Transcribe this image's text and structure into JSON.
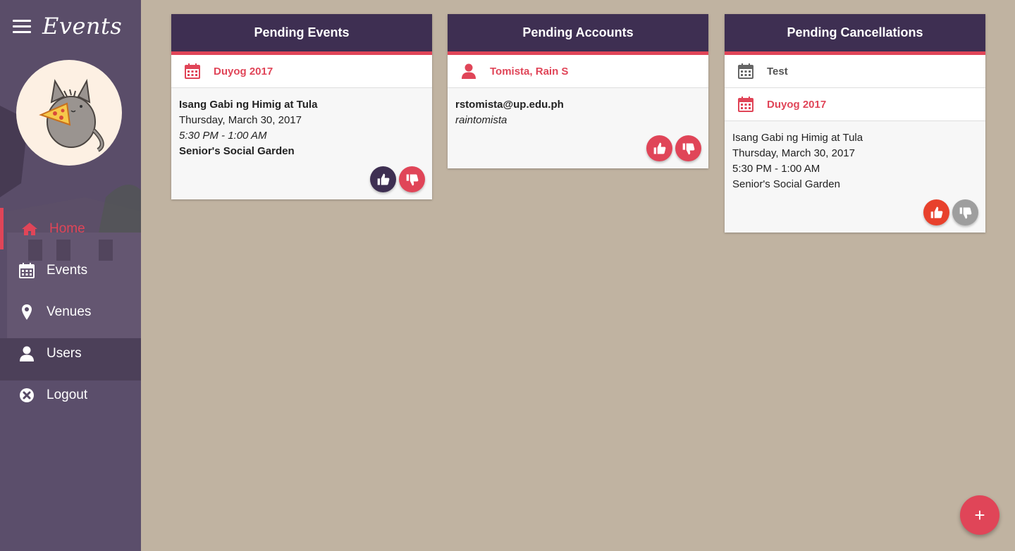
{
  "app": {
    "brand": "Events"
  },
  "sidebar": {
    "items": [
      {
        "label": "Home",
        "icon": "home-icon",
        "active": true
      },
      {
        "label": "Events",
        "icon": "calendar-icon"
      },
      {
        "label": "Venues",
        "icon": "map-pin-icon"
      },
      {
        "label": "Users",
        "icon": "user-icon"
      },
      {
        "label": "Logout",
        "icon": "close-circle-icon"
      }
    ]
  },
  "colors": {
    "accent": "#e04558",
    "header": "#3e2f52",
    "background": "#c0b3a1",
    "approve_dark": "#3e2f52",
    "approve_red": "#e8412c",
    "disabled": "#9e9e9e"
  },
  "cards": {
    "pending_events": {
      "title": "Pending Events",
      "item": "Duyog 2017",
      "details": {
        "name": "Isang Gabi ng Himig at Tula",
        "date": "Thursday, March 30, 2017",
        "time": "5:30 PM - 1:00 AM",
        "venue": "Senior's Social Garden"
      }
    },
    "pending_accounts": {
      "title": "Pending Accounts",
      "item": "Tomista, Rain S",
      "details": {
        "email": "rstomista@up.edu.ph",
        "username": "raintomista"
      }
    },
    "pending_cancellations": {
      "title": "Pending Cancellations",
      "items": [
        "Test",
        "Duyog 2017"
      ],
      "details": {
        "name": "Isang Gabi ng Himig at Tula",
        "date": "Thursday, March 30, 2017",
        "time": "5:30 PM - 1:00 AM",
        "venue": "Senior's Social Garden"
      }
    }
  },
  "fab": {
    "label": "+"
  }
}
